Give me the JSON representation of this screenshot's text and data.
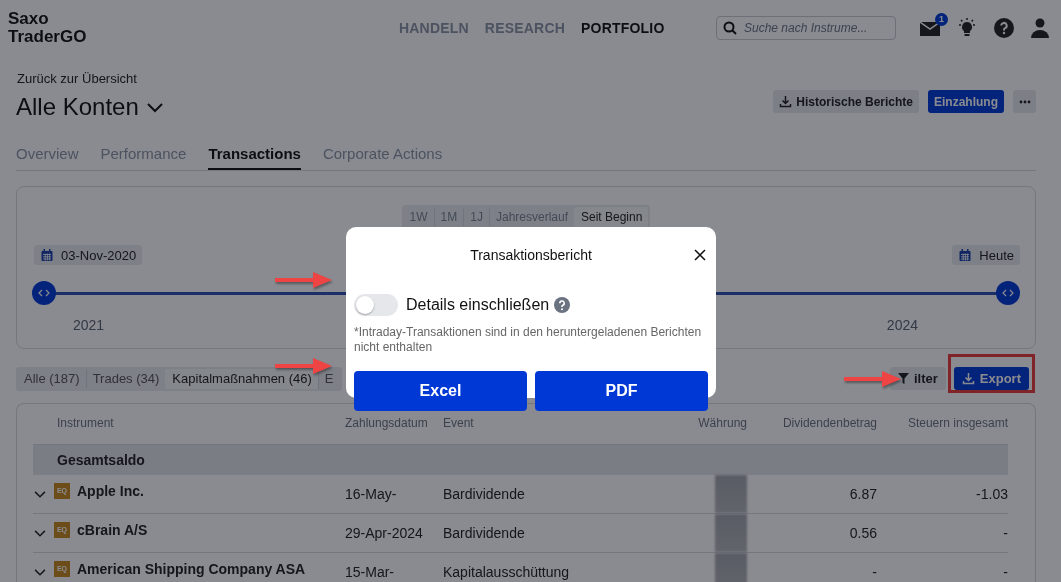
{
  "header": {
    "logo": "Saxo TraderGO",
    "nav": [
      {
        "label": "HANDELN",
        "selected": false
      },
      {
        "label": "RESEARCH",
        "selected": false
      },
      {
        "label": "PORTFOLIO",
        "selected": true
      }
    ],
    "search": {
      "placeholder": "Suche nach Instrume..."
    },
    "mail_badge": "1"
  },
  "page": {
    "back_link": "Zurück zur Übersicht",
    "title": "Alle Konten",
    "buttons": [
      {
        "kind": "download",
        "label": "Historische Berichte"
      },
      {
        "kind": "primary",
        "label": "Einzahlung"
      },
      {
        "kind": "more"
      }
    ]
  },
  "tabs": [
    {
      "label": "Overview",
      "selected": false
    },
    {
      "label": "Performance",
      "selected": false
    },
    {
      "label": "Transactions",
      "selected": true
    },
    {
      "label": "Corporate Actions",
      "selected": false
    }
  ],
  "timeline": {
    "periods": [
      {
        "label": "1W",
        "selected": false
      },
      {
        "label": "1M",
        "selected": false
      },
      {
        "label": "1J",
        "selected": false
      },
      {
        "label": "Jahresverlauf",
        "selected": false
      },
      {
        "label": "Seit Beginn",
        "selected": true
      }
    ],
    "start_date": "03-Nov-2020",
    "end_date": "Heute",
    "start_handle": {
      "level": 0
    },
    "end_handle": {
      "level": 1
    },
    "years": [
      "2021",
      "2024"
    ]
  },
  "filters": [
    {
      "label": "Alle (187)",
      "selected": false
    },
    {
      "label": "Trades (34)",
      "selected": false
    },
    {
      "label": "Kapitalmaßnahmen (46)",
      "selected": true
    },
    {
      "label": "E",
      "selected": false
    }
  ],
  "actions": [
    {
      "kind": "filter",
      "label": "ilter",
      "highlighted": false
    },
    {
      "kind": "export",
      "label": "Export",
      "highlighted": true
    }
  ],
  "table": {
    "columns": [
      "Instrument",
      "Zahlungsdatum",
      "Event",
      "Währung",
      "Dividendenbetrag",
      "Steuern insgesamt"
    ],
    "total_row": "Gesamtsaldo",
    "rows": [
      {
        "type": "EQ",
        "instrument": "Apple Inc.",
        "date": "16-May-",
        "event": "Bardividende",
        "dividend": "6.87",
        "taxes": "-1.03"
      },
      {
        "type": "EQ",
        "instrument": "cBrain A/S",
        "date": "29-Apr-2024",
        "event": "Bardividende",
        "dividend": "0.56",
        "taxes": "-"
      },
      {
        "type": "EQ",
        "instrument": "American Shipping Company ASA",
        "date": "15-Mar-",
        "event": "Kapitalausschüttung",
        "dividend": "-",
        "taxes": "-"
      }
    ]
  },
  "dialog": {
    "title": "Transaktionsbericht",
    "toggle": {
      "label": "Details einschließen",
      "on": false
    },
    "note": "*Intraday-Transaktionen sind in den heruntergeladenen Berichten nicht enthalten",
    "buttons": [
      "Excel",
      "PDF"
    ]
  }
}
